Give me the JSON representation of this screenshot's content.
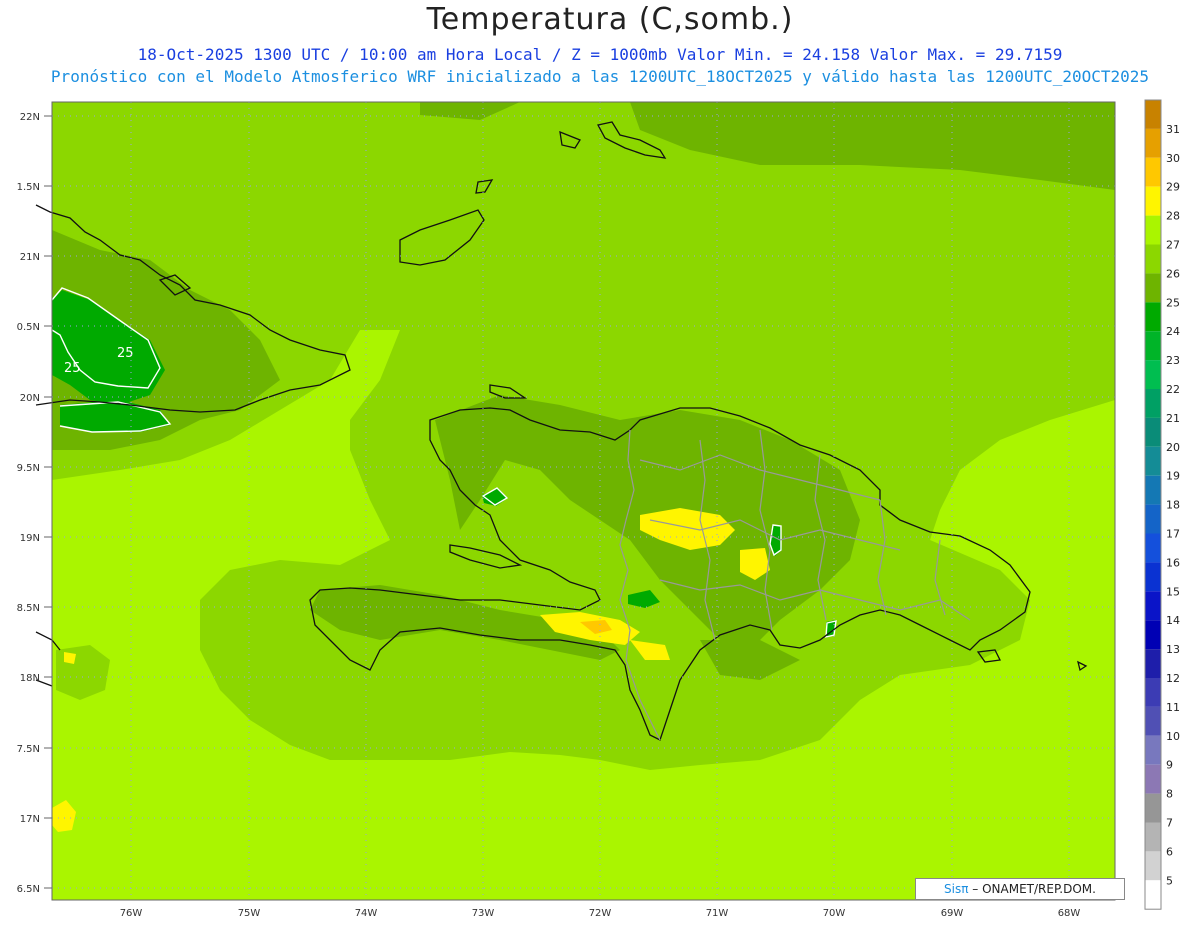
{
  "title": "Temperatura (C,somb.)",
  "subtitle_line1": "18-Oct-2025 1300 UTC / 10:00 am Hora Local / Z = 1000mb   Valor Min. = 24.158  Valor Max. = 29.7159",
  "subtitle_line2": "Pronóstico con el Modelo Atmosferico WRF inicializado a las 1200UTC_18OCT2025 y válido hasta las  1200UTC_20OCT2025",
  "lat_labels": [
    "22N",
    "1.5N",
    "21N",
    "0.5N",
    "20N",
    "9.5N",
    "19N",
    "8.5N",
    "18N",
    "7.5N",
    "17N",
    "6.5N"
  ],
  "lon_labels": [
    "76W",
    "75W",
    "74W",
    "73W",
    "72W",
    "71W",
    "70W",
    "69W",
    "68W"
  ],
  "contour_label": "25",
  "colorbar": {
    "levels": [
      "31",
      "30",
      "29",
      "28",
      "27",
      "26",
      "25",
      "24",
      "23",
      "22",
      "21",
      "20",
      "19",
      "18",
      "17",
      "16",
      "15",
      "14",
      "13",
      "12",
      "11",
      "10",
      "9",
      "8",
      "7",
      "6",
      "5"
    ],
    "colors": [
      "#c88200",
      "#e6a000",
      "#ffc800",
      "#fff500",
      "#aaf500",
      "#8cd700",
      "#6eb400",
      "#00aa00",
      "#00b428",
      "#00be50",
      "#00a064",
      "#0a8c78",
      "#148c96",
      "#1478b4",
      "#1464c8",
      "#1450dc",
      "#0a32d2",
      "#0a14c8",
      "#0000b4",
      "#1e1eaa",
      "#3c3cb4",
      "#5050b4",
      "#7878be",
      "#8c78b4",
      "#969696",
      "#b4b4b4",
      "#d2d2d2",
      "#ffffff"
    ]
  },
  "credit": {
    "brand": "Sisπ",
    "text": "– ONAMET/REP.DOM."
  }
}
